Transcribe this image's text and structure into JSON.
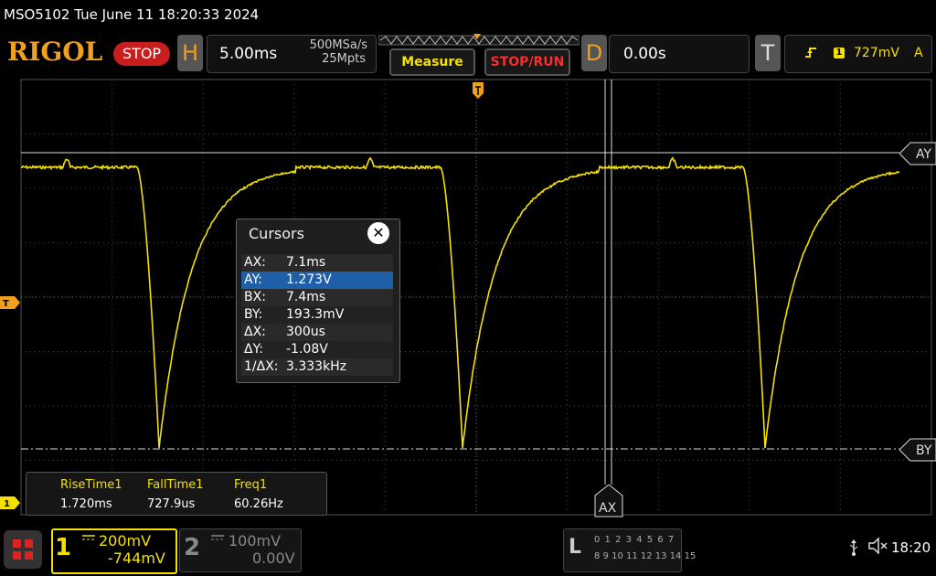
{
  "title_bar": {
    "text": "MSO5102  Tue June 11 18:20:33 2024"
  },
  "brand": {
    "logo": "RIGOL",
    "run_state": "STOP"
  },
  "horizontal": {
    "letter": "H",
    "timebase": "5.00ms",
    "sample_rate": "500MSa/s",
    "memory_depth": "25Mpts"
  },
  "toolbar": {
    "measure_label": "Measure",
    "stop_run_label": "STOP/RUN"
  },
  "delay": {
    "letter": "D",
    "value": "0.00s"
  },
  "trigger": {
    "letter": "T",
    "source": "1",
    "level": "727mV",
    "mode": "A",
    "edge_icon": "rising-edge-icon"
  },
  "cursor_markers": {
    "ay": "AY",
    "by": "BY",
    "ax": "AX"
  },
  "cursors": {
    "title": "Cursors",
    "close": "✕",
    "rows": [
      {
        "label": "AX:",
        "value": "7.1ms",
        "selected": false
      },
      {
        "label": "AY:",
        "value": "1.273V",
        "selected": true
      },
      {
        "label": "BX:",
        "value": "7.4ms",
        "selected": false
      },
      {
        "label": "BY:",
        "value": "193.3mV",
        "selected": false
      },
      {
        "label": "ΔX:",
        "value": "300us",
        "selected": false
      },
      {
        "label": "ΔY:",
        "value": "-1.08V",
        "selected": false
      },
      {
        "label": "1/ΔX:",
        "value": "3.333kHz",
        "selected": false
      }
    ]
  },
  "measurements": [
    {
      "name": "RiseTime1",
      "value": "1.720ms"
    },
    {
      "name": "FallTime1",
      "value": "727.9us"
    },
    {
      "name": "Freq1",
      "value": "60.26Hz"
    }
  ],
  "left_markers": {
    "trigger_level": "T",
    "channel_1": "1"
  },
  "channel_1": {
    "number": "1",
    "scale": "200mV",
    "offset": "-744mV",
    "coupling_icon": "dc-coupling-icon",
    "color": "#f5e100"
  },
  "channel_2": {
    "number": "2",
    "scale": "100mV",
    "offset": "0.00V",
    "coupling_icon": "dc-coupling-icon",
    "color": "#888888"
  },
  "logic": {
    "letter": "L",
    "row1": "0 1 2 3  4 5 6 7",
    "row2": "8 9 10 11 12 13 14 15"
  },
  "status": {
    "time": "18:20",
    "usb_icon": "usb-icon",
    "speaker_icon": "speaker-muted-icon"
  },
  "colors": {
    "trace": "#f5e100",
    "accent": "#f0a020",
    "stop": "#c81e1e",
    "selected_row": "#1f5fa8"
  }
}
